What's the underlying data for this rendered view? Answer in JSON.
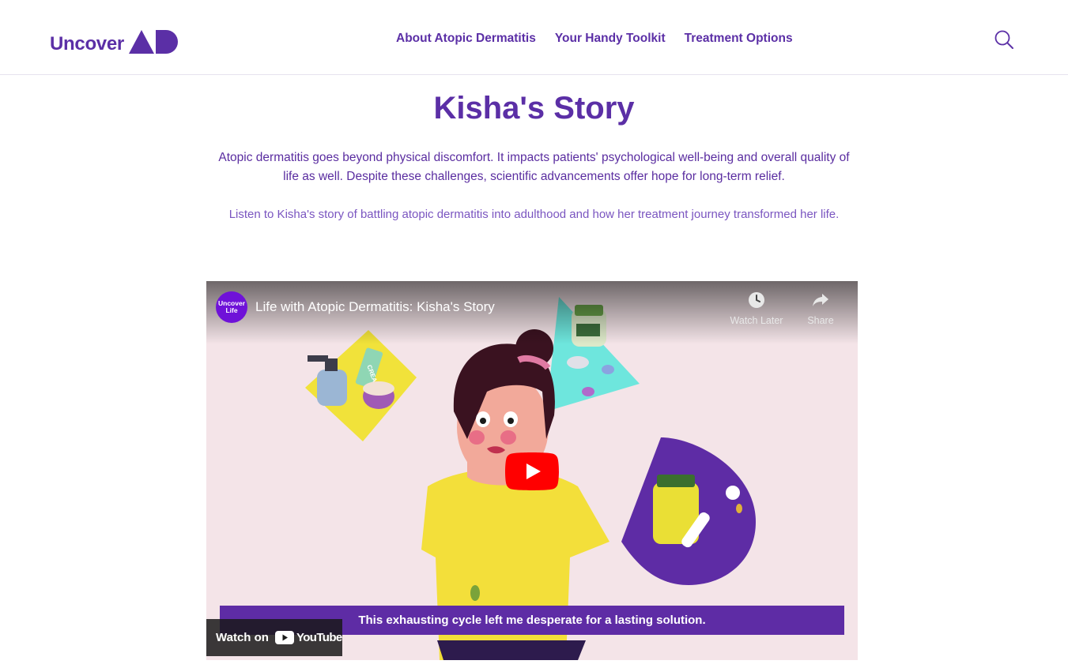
{
  "header": {
    "logo": {
      "text": "Uncover",
      "mark_text": "AD",
      "brand_color": "#5b2fa6"
    },
    "nav": [
      {
        "label": "About Atopic Dermatitis"
      },
      {
        "label": "Your Handy Toolkit"
      },
      {
        "label": "Treatment Options"
      }
    ],
    "search_icon": "search-icon"
  },
  "main": {
    "title": "Kisha's Story",
    "intro": "Atopic dermatitis goes beyond physical discomfort. It impacts patients' psychological well-being and overall quality of life as well. Despite these challenges, scientific advancements offer hope for long-term relief.",
    "lead": "Listen to Kisha's story of battling atopic dermatitis into adulthood and how her treatment journey transformed her life."
  },
  "video": {
    "channel_avatar_text": "Uncover Life",
    "title": "Life with Atopic Dermatitis: Kisha's Story",
    "watch_later_label": "Watch Later",
    "share_label": "Share",
    "caption": "This exhausting cycle left me desperate for a lasting solution.",
    "watch_on_label": "Watch on",
    "youtube_label": "YouTube",
    "cream_label": "CREAM",
    "colors": {
      "play_button": "#ff0000",
      "caption_bg": "#5e2ca5",
      "channel_avatar": "#6f12d8"
    }
  }
}
